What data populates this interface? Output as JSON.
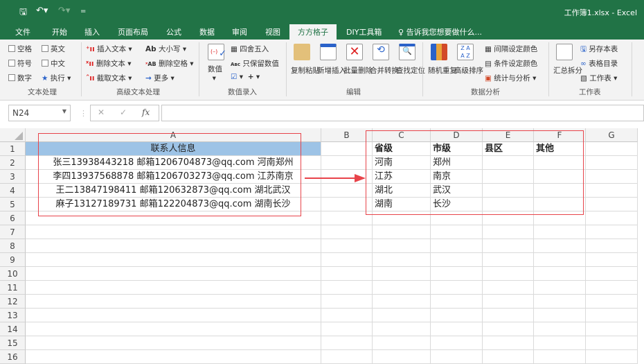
{
  "titlebar": {
    "title": "工作簿1.xlsx - Excel",
    "save_icon": "save-icon",
    "undo_icon": "undo-icon",
    "redo_icon": "redo-icon",
    "customize": "="
  },
  "tabs": [
    "文件",
    "开始",
    "插入",
    "页面布局",
    "公式",
    "数据",
    "审阅",
    "视图",
    "方方格子",
    "DIY工具箱"
  ],
  "active_tab": "方方格子",
  "tell_me": "告诉我您想要做什么...",
  "ribbon": {
    "text_processing": {
      "label": "文本处理",
      "items": [
        "空格",
        "英文",
        "符号",
        "中文",
        "数字",
        "执行"
      ]
    },
    "advanced_text": {
      "label": "高级文本处理",
      "items": [
        "插入文本",
        "删除文本",
        "截取文本",
        "大小写",
        "删除空格",
        "更多"
      ]
    },
    "numeric_entry": {
      "label": "数值录入",
      "items": [
        "数值",
        "四舍五入",
        "只保留数值"
      ]
    },
    "edit": {
      "label": "编辑",
      "items": [
        "复制粘贴",
        "新增插入",
        "批量删除",
        "合并转换",
        "查找定位"
      ]
    },
    "data_analysis": {
      "label": "数据分析",
      "items": [
        "随机重复",
        "高级排序",
        "间隔设定颜色",
        "条件设定颜色",
        "统计与分析"
      ]
    },
    "worksheet": {
      "label": "工作表",
      "items": [
        "汇总拆分",
        "另存本表",
        "表格目录",
        "工作表"
      ]
    }
  },
  "formula_bar": {
    "name_box": "N24",
    "fx": "fx",
    "value": ""
  },
  "sheet": {
    "columns": [
      "A",
      "B",
      "C",
      "D",
      "E",
      "F",
      "G"
    ],
    "rows": [
      "1",
      "2",
      "3",
      "4",
      "5",
      "6",
      "7",
      "8",
      "9",
      "10",
      "11",
      "12",
      "13",
      "14",
      "15",
      "16"
    ],
    "A": [
      "联系人信息",
      "张三13938443218 邮箱1206704873@qq.com 河南郑州",
      "李四13937568878 邮箱1206703273@qq.com 江苏南京",
      "王二13847198411 邮箱120632873@qq.com 湖北武汉",
      "麻子13127189731 邮箱122204873@qq.com 湖南长沙"
    ],
    "headers": [
      "省级",
      "市级",
      "县区",
      "其他"
    ],
    "C": [
      "河南",
      "江苏",
      "湖北",
      "湖南"
    ],
    "D": [
      "郑州",
      "南京",
      "武汉",
      "长沙"
    ],
    "header_fill": "#9dc3e6",
    "annotation_color": "#e8434a"
  }
}
